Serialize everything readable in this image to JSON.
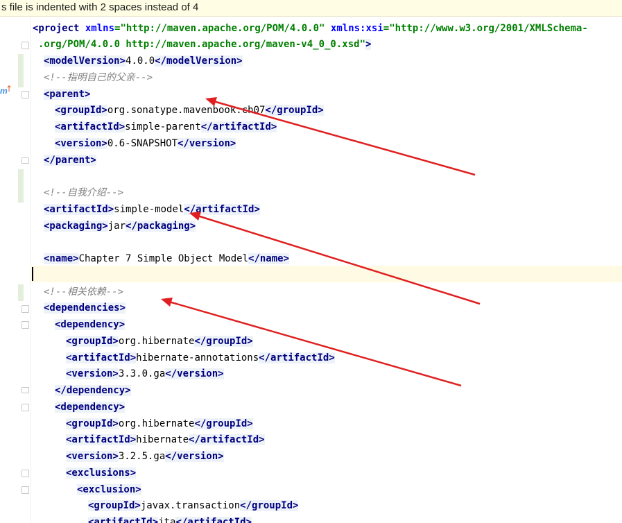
{
  "banner": {
    "text": "s file is indented with 2 spaces instead of 4"
  },
  "gutter": {
    "maven_icon": "maven-m-icon",
    "up_arrow": "↑"
  },
  "code": {
    "l1": {
      "open": "<project ",
      "attr1": "xmlns",
      "eq1": "=",
      "val1": "\"http://maven.apache.org/POM/4.0.0\"",
      "sp": " ",
      "attr2": "xmlns:xsi",
      "eq2": "=",
      "val2": "\"http://www.w3.org/2001/XMLSchema-"
    },
    "l2": {
      "val": ".org/POM/4.0.0 http://maven.apache.org/maven-v4_0_0.xsd\"",
      "close": ">"
    },
    "l3": {
      "t_open": "<modelVersion>",
      "text": "4.0.0",
      "t_close": "</modelVersion>"
    },
    "l4": {
      "comment": "<!--指明自己的父亲-->"
    },
    "l5": {
      "t_open": "<parent>"
    },
    "l6": {
      "t_open": "<groupId>",
      "text": "org.sonatype.mavenbook.ch07",
      "t_close": "</groupId>"
    },
    "l7": {
      "t_open": "<artifactId>",
      "text": "simple-parent",
      "t_close": "</artifactId>"
    },
    "l8": {
      "t_open": "<version>",
      "text": "0.6-SNAPSHOT",
      "t_close": "</version>"
    },
    "l9": {
      "t_close": "</parent>"
    },
    "l11": {
      "comment": "<!--自我介绍-->"
    },
    "l12": {
      "t_open": "<artifactId>",
      "text": "simple-model",
      "t_close": "</artifactId>"
    },
    "l13": {
      "t_open": "<packaging>",
      "text": "jar",
      "t_close": "</packaging>"
    },
    "l15": {
      "t_open": "<name>",
      "text": "Chapter 7 Simple Object Model",
      "t_close": "</name>"
    },
    "l17": {
      "comment": "<!--相关依赖-->"
    },
    "l18": {
      "t_open": "<dependencies>"
    },
    "l19": {
      "t_open": "<dependency>"
    },
    "l20": {
      "t_open": "<groupId>",
      "text": "org.hibernate",
      "t_close": "</groupId>"
    },
    "l21": {
      "t_open": "<artifactId>",
      "text": "hibernate-annotations",
      "t_close": "</artifactId>"
    },
    "l22": {
      "t_open": "<version>",
      "text": "3.3.0.ga",
      "t_close": "</version>"
    },
    "l23": {
      "t_close": "</dependency>"
    },
    "l24": {
      "t_open": "<dependency>"
    },
    "l25": {
      "t_open": "<groupId>",
      "text": "org.hibernate",
      "t_close": "</groupId>"
    },
    "l26": {
      "t_open": "<artifactId>",
      "text": "hibernate",
      "t_close": "</artifactId>"
    },
    "l27": {
      "t_open": "<version>",
      "text": "3.2.5.ga",
      "t_close": "</version>"
    },
    "l28": {
      "t_open": "<exclusions>"
    },
    "l29": {
      "t_open": "<exclusion>"
    },
    "l30": {
      "t_open": "<groupId>",
      "text": "javax.transaction",
      "t_close": "</groupId>"
    },
    "l31": {
      "t_open": "<artifactId>",
      "text": "jta",
      "t_close": "</artifactId>"
    }
  },
  "annotations": {
    "arrow_color": "#e02020"
  }
}
